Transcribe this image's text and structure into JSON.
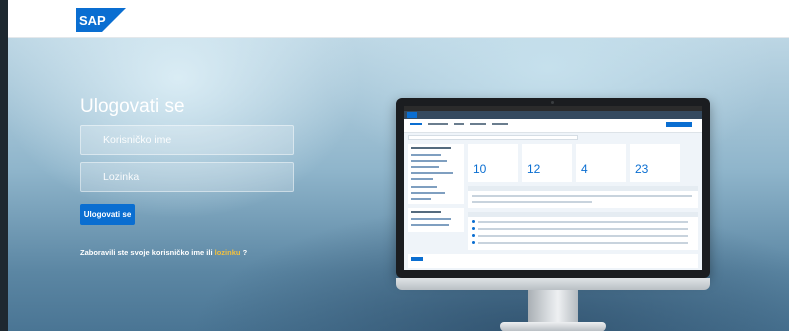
{
  "header": {
    "logo_text": "SAP",
    "logo_color": "#0a6ed1"
  },
  "login": {
    "title": "Ulogovati se",
    "username_placeholder": "Korisničko ime",
    "password_placeholder": "Lozinka",
    "submit_label": "Ulogovati se",
    "forgot_text": "Zaboravili ste svoje korisničko ime ili ",
    "forgot_link": "lozinku",
    "forgot_suffix": " ?"
  },
  "preview": {
    "tiles": [
      {
        "value": "10"
      },
      {
        "value": "12"
      },
      {
        "value": "4"
      },
      {
        "value": "23"
      }
    ]
  },
  "colors": {
    "accent": "#0a6ed1",
    "link": "#f0c040",
    "text": "#ffffff"
  }
}
